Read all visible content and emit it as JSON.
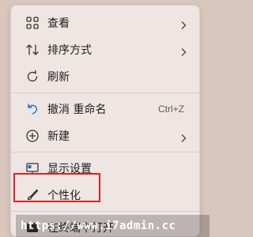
{
  "menu": {
    "items": [
      {
        "label": "查看",
        "icon": "grid-icon",
        "has_submenu": true
      },
      {
        "label": "排序方式",
        "icon": "sort-icon",
        "has_submenu": true
      },
      {
        "label": "刷新",
        "icon": "refresh-icon",
        "has_submenu": false
      },
      {
        "label": "撤消 重命名",
        "icon": "undo-icon",
        "shortcut": "Ctrl+Z"
      },
      {
        "label": "新建",
        "icon": "new-icon",
        "has_submenu": true
      },
      {
        "label": "显示设置",
        "icon": "display-icon",
        "has_submenu": false
      },
      {
        "label": "个性化",
        "icon": "brush-icon",
        "has_submenu": false
      },
      {
        "label": "在终端中打开",
        "icon": "terminal-icon",
        "has_submenu": false
      }
    ]
  },
  "watermark": {
    "text": "https://www.i7admin.cc"
  },
  "colors": {
    "highlight_border": "#e02020",
    "accent_icon": "#1a73c8"
  }
}
